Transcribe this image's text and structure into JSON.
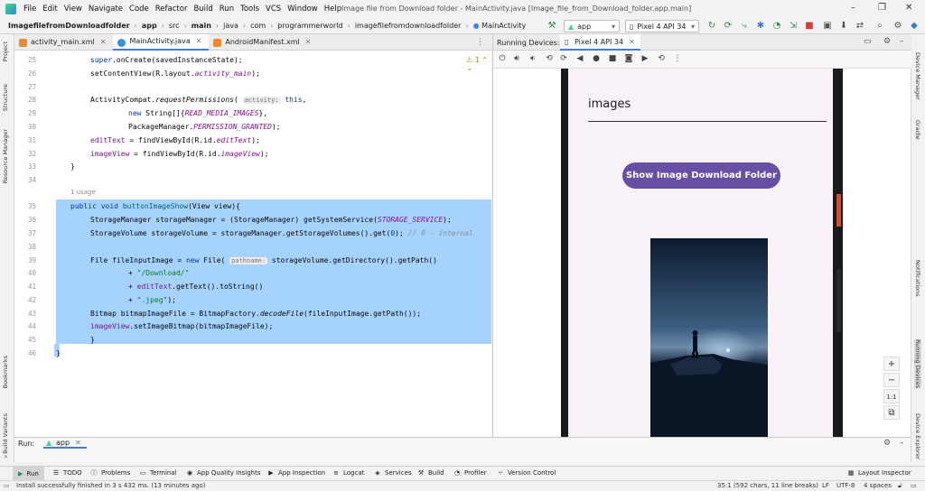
{
  "menubar": {
    "items": [
      "File",
      "Edit",
      "View",
      "Navigate",
      "Code",
      "Refactor",
      "Build",
      "Run",
      "Tools",
      "VCS",
      "Window",
      "Help"
    ],
    "window_title": "Image file from Download folder - MainActivity.java [Image_file_from_Download_folder.app.main]"
  },
  "navbar": {
    "breadcrumbs": [
      "ImagefilefromDownloadfolder",
      "app",
      "src",
      "main",
      "java",
      "com",
      "programmerworld",
      "imagefilefromdownloadfolder",
      "MainActivity"
    ],
    "run_config": "app",
    "device": "Pixel 4 API 34"
  },
  "left_stripe": [
    "Project",
    "Structure",
    "Resource Manager",
    "Bookmarks",
    "Build Variants"
  ],
  "right_stripe": [
    "Device Manager",
    "Gradle",
    "Notifications",
    "Running Devices",
    "Device Explorer"
  ],
  "editor": {
    "tabs": [
      {
        "label": "activity_main.xml",
        "color": "#e98a2e"
      },
      {
        "label": "MainActivity.java",
        "color": "#3d8ed8"
      },
      {
        "label": "AndroidManifest.xml",
        "color": "#e98a2e"
      }
    ],
    "warning_count": "1",
    "usage_hint": "1 usage",
    "line_numbers": [
      "25",
      "26",
      "27",
      "28",
      "29",
      "30",
      "31",
      "32",
      "33",
      "34",
      "35",
      "36",
      "37",
      "38",
      "39",
      "40",
      "41",
      "42",
      "43",
      "44",
      "45",
      "46"
    ],
    "hint_activity": "activity:",
    "hint_pathname": "pathname:"
  },
  "running_devices": {
    "label": "Running Devices:",
    "device_tab": "Pixel 4 API 34"
  },
  "app_screen": {
    "field_text": "images",
    "button_label": "Show Image Download Folder"
  },
  "zoom": {
    "plus": "+",
    "minus": "−",
    "one_to_one": "1:1"
  },
  "run_panel": {
    "label": "Run:",
    "tab": "app"
  },
  "tool_windows": [
    "Run",
    "TODO",
    "Problems",
    "Terminal",
    "App Quality Insights",
    "App Inspection",
    "Logcat",
    "Services",
    "Build",
    "Profiler",
    "Version Control",
    "Layout Inspector"
  ],
  "status": {
    "message": "Install successfully finished in 3 s 432 ms. (13 minutes ago)",
    "position": "35:1 (592 chars, 11 line breaks)",
    "line_sep": "LF",
    "encoding": "UTF-8",
    "indent": "4 spaces"
  },
  "colors": {
    "selection": "#a6d2ff",
    "button": "#6750a4",
    "accent": "#4a7bd0"
  }
}
